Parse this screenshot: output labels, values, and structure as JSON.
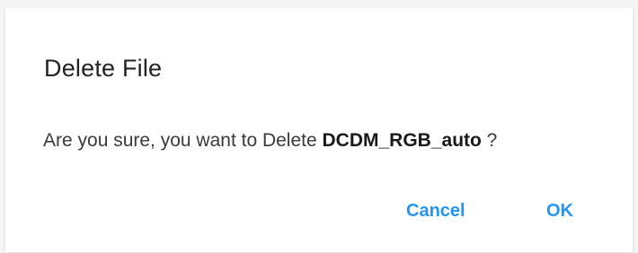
{
  "dialog": {
    "title": "Delete File",
    "message_prefix": "Are you sure, you want to Delete ",
    "filename": "DCDM_RGB_auto",
    "message_suffix": " ?",
    "cancel_label": "Cancel",
    "ok_label": "OK"
  },
  "colors": {
    "accent": "#2196f3",
    "title": "#222222",
    "text": "#3a3a3a"
  }
}
